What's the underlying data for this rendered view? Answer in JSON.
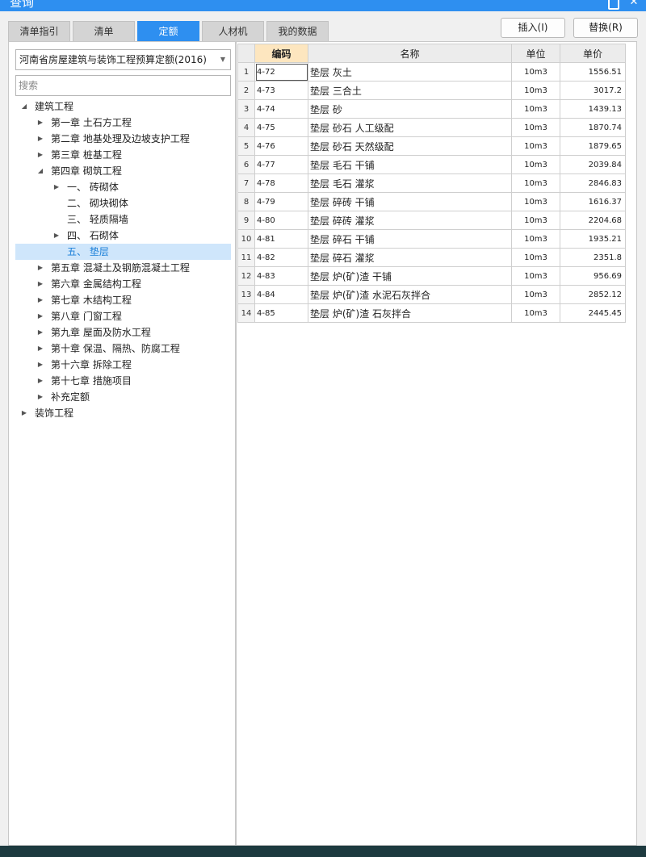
{
  "window": {
    "title": "查询"
  },
  "tabs": [
    {
      "label": "清单指引",
      "active": false
    },
    {
      "label": "清单",
      "active": false
    },
    {
      "label": "定额",
      "active": true
    },
    {
      "label": "人材机",
      "active": false
    },
    {
      "label": "我的数据",
      "active": false
    }
  ],
  "toolbar": {
    "insert_label": "插入(I)",
    "replace_label": "替换(R)"
  },
  "quota_library": {
    "selected": "河南省房屋建筑与装饰工程预算定额(2016)"
  },
  "search": {
    "placeholder": "搜索",
    "value": ""
  },
  "tree": [
    {
      "label": "建筑工程",
      "level": 0,
      "arrow": "expanded"
    },
    {
      "label": "第一章 土石方工程",
      "level": 1,
      "arrow": "collapsed"
    },
    {
      "label": "第二章 地基处理及边坡支护工程",
      "level": 1,
      "arrow": "collapsed"
    },
    {
      "label": "第三章 桩基工程",
      "level": 1,
      "arrow": "collapsed"
    },
    {
      "label": "第四章 砌筑工程",
      "level": 1,
      "arrow": "expanded"
    },
    {
      "label": "一、 砖砌体",
      "level": 2,
      "arrow": "collapsed"
    },
    {
      "label": "二、 砌块砌体",
      "level": 2,
      "arrow": "none"
    },
    {
      "label": "三、 轻质隔墙",
      "level": 2,
      "arrow": "none"
    },
    {
      "label": "四、 石砌体",
      "level": 2,
      "arrow": "collapsed"
    },
    {
      "label": "五、 垫层",
      "level": 2,
      "arrow": "none",
      "selected": true
    },
    {
      "label": "第五章 混凝土及钢筋混凝土工程",
      "level": 1,
      "arrow": "collapsed"
    },
    {
      "label": "第六章 金属结构工程",
      "level": 1,
      "arrow": "collapsed"
    },
    {
      "label": "第七章 木结构工程",
      "level": 1,
      "arrow": "collapsed"
    },
    {
      "label": "第八章 门窗工程",
      "level": 1,
      "arrow": "collapsed"
    },
    {
      "label": "第九章 屋面及防水工程",
      "level": 1,
      "arrow": "collapsed"
    },
    {
      "label": "第十章 保温、隔热、防腐工程",
      "level": 1,
      "arrow": "collapsed"
    },
    {
      "label": "第十六章 拆除工程",
      "level": 1,
      "arrow": "collapsed"
    },
    {
      "label": "第十七章 措施项目",
      "level": 1,
      "arrow": "collapsed"
    },
    {
      "label": "补充定额",
      "level": 1,
      "arrow": "collapsed"
    },
    {
      "label": "装饰工程",
      "level": 0,
      "arrow": "collapsed"
    }
  ],
  "table": {
    "columns": [
      "",
      "编码",
      "名称",
      "单位",
      "单价"
    ],
    "rows": [
      {
        "n": "1",
        "code": "4-72",
        "name": "垫层 灰土",
        "unit": "10m3",
        "price": "1556.51"
      },
      {
        "n": "2",
        "code": "4-73",
        "name": "垫层 三合土",
        "unit": "10m3",
        "price": "3017.2"
      },
      {
        "n": "3",
        "code": "4-74",
        "name": "垫层 砂",
        "unit": "10m3",
        "price": "1439.13"
      },
      {
        "n": "4",
        "code": "4-75",
        "name": "垫层 砂石 人工级配",
        "unit": "10m3",
        "price": "1870.74"
      },
      {
        "n": "5",
        "code": "4-76",
        "name": "垫层 砂石 天然级配",
        "unit": "10m3",
        "price": "1879.65"
      },
      {
        "n": "6",
        "code": "4-77",
        "name": "垫层 毛石 干铺",
        "unit": "10m3",
        "price": "2039.84"
      },
      {
        "n": "7",
        "code": "4-78",
        "name": "垫层 毛石 灌浆",
        "unit": "10m3",
        "price": "2846.83"
      },
      {
        "n": "8",
        "code": "4-79",
        "name": "垫层 碎砖 干铺",
        "unit": "10m3",
        "price": "1616.37"
      },
      {
        "n": "9",
        "code": "4-80",
        "name": "垫层 碎砖 灌浆",
        "unit": "10m3",
        "price": "2204.68"
      },
      {
        "n": "10",
        "code": "4-81",
        "name": "垫层 碎石 干铺",
        "unit": "10m3",
        "price": "1935.21"
      },
      {
        "n": "11",
        "code": "4-82",
        "name": "垫层 碎石 灌浆",
        "unit": "10m3",
        "price": "2351.8"
      },
      {
        "n": "12",
        "code": "4-83",
        "name": "垫层 炉(矿)渣 干铺",
        "unit": "10m3",
        "price": "956.69"
      },
      {
        "n": "13",
        "code": "4-84",
        "name": "垫层 炉(矿)渣 水泥石灰拌合",
        "unit": "10m3",
        "price": "2852.12"
      },
      {
        "n": "14",
        "code": "4-85",
        "name": "垫层 炉(矿)渣 石灰拌合",
        "unit": "10m3",
        "price": "2445.45"
      }
    ]
  },
  "icons": {
    "tree_expanded": "◢",
    "tree_collapsed": "▶",
    "dropdown": "▼",
    "window_close": "✕"
  },
  "colors": {
    "accent": "#2e8ff0",
    "selected_row": "#cfe6fb",
    "sorted_header": "#fde6bf"
  }
}
